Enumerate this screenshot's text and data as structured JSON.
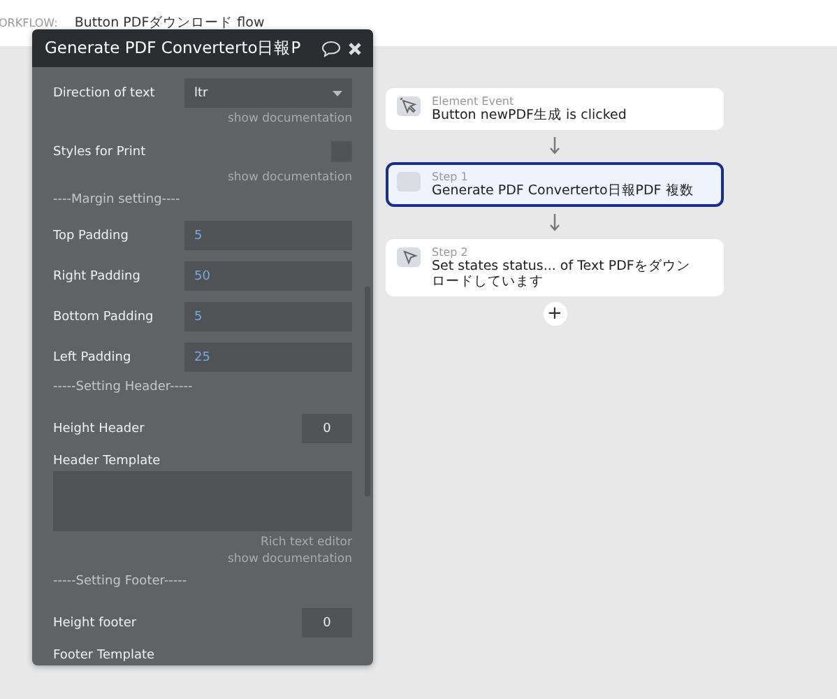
{
  "top_bar": {
    "label": "ORKFLOW:",
    "workflow_name": "Button PDFダウンロード flow"
  },
  "panel": {
    "title": "Generate PDF Converterto日報P",
    "fields": [
      {
        "kind": "dropdown",
        "label": "Direction of text",
        "value": "ltr",
        "notes": [
          "show documentation"
        ]
      },
      {
        "kind": "checkbox",
        "label": "Styles for Print",
        "checked": false,
        "notes": [
          "show documentation"
        ]
      },
      {
        "kind": "heading",
        "label": "----Margin setting----"
      },
      {
        "kind": "text",
        "label": "Top Padding",
        "value": "5"
      },
      {
        "kind": "text",
        "label": "Right Padding",
        "value": "50"
      },
      {
        "kind": "text",
        "label": "Bottom Padding",
        "value": "5"
      },
      {
        "kind": "text",
        "label": "Left Padding",
        "value": "25"
      },
      {
        "kind": "heading",
        "label": "-----Setting Header-----"
      },
      {
        "kind": "number",
        "label": "Height Header",
        "value": "0"
      },
      {
        "kind": "textarea",
        "label": "Header Template",
        "notes": [
          "Rich text editor",
          "show documentation"
        ]
      },
      {
        "kind": "heading",
        "label": "-----Setting Footer-----"
      },
      {
        "kind": "number",
        "label": "Height footer",
        "value": "0"
      },
      {
        "kind": "textarea",
        "label": "Footer Template"
      }
    ]
  },
  "flow": [
    {
      "caption": "Element Event",
      "text": "Button newPDF生成 is clicked",
      "selected": false
    },
    {
      "caption": "Step 1",
      "text": "Generate PDF Converterto日報PDF 複数",
      "selected": true
    },
    {
      "caption": "Step 2",
      "text": "Set states status... of Text PDFをダウンロードしています",
      "selected": false
    }
  ],
  "add_button": "+"
}
